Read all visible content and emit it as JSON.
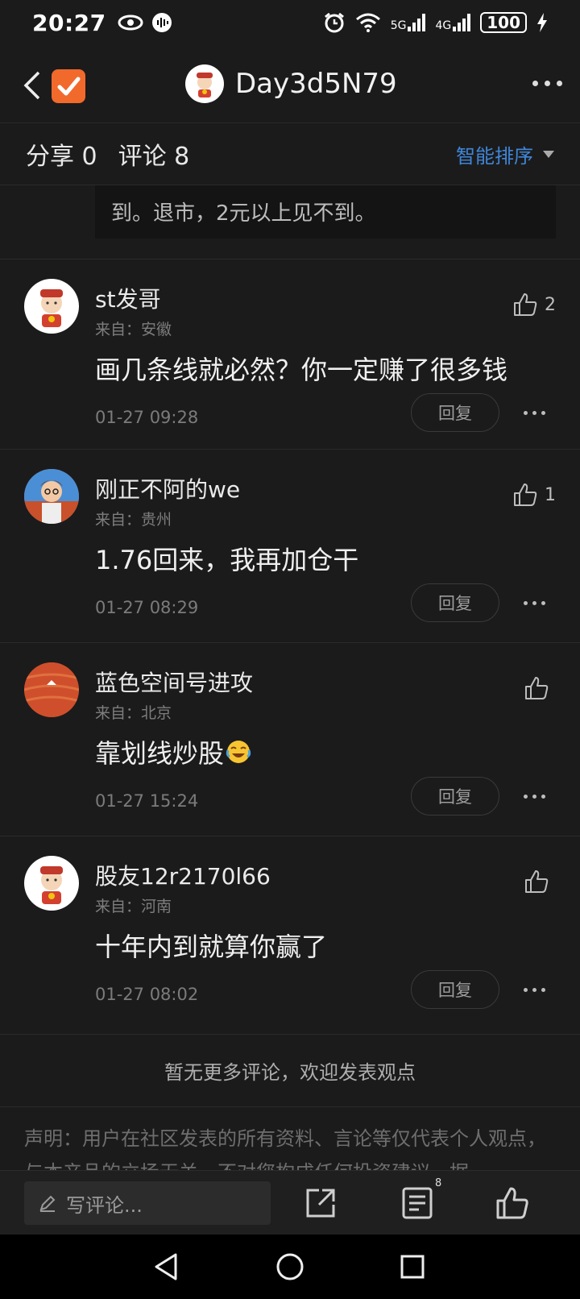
{
  "status_bar": {
    "time": "20:27",
    "battery": "100",
    "net1": "5G",
    "net2": "4G"
  },
  "topnav": {
    "title": "Day3d5N79"
  },
  "tabs": {
    "share": "分享 0",
    "comments": "评论 8",
    "sort": "智能排序"
  },
  "snippet": {
    "text": "到。退市，2元以上见不到。"
  },
  "comments": [
    {
      "name": "st发哥",
      "location": "来自：安徽",
      "text": "画几条线就必然？你一定赚了很多钱",
      "time": "01-27 09:28",
      "likes": "2",
      "reply": "回复"
    },
    {
      "name": "刚正不阿的we",
      "location": "来自：贵州",
      "text": "1.76回来，我再加仓干",
      "time": "01-27 08:29",
      "likes": "1",
      "reply": "回复"
    },
    {
      "name": "蓝色空间号进攻",
      "location": "来自：北京",
      "text": "靠划线炒股",
      "time": "01-27 15:24",
      "likes": "",
      "reply": "回复"
    },
    {
      "name": "股友12r2170l66",
      "location": "来自：河南",
      "text": "十年内到就算你赢了",
      "time": "01-27 08:02",
      "likes": "",
      "reply": "回复"
    }
  ],
  "no_more": "暂无更多评论，欢迎发表观点",
  "disclaimer": "声明：用户在社区发表的所有资料、言论等仅代表个人观点，与本产品的立场无关，不对您构成任何投资建议，据",
  "bottom_bar": {
    "write_placeholder": "写评论...",
    "comment_count": "8"
  },
  "colors": {
    "background": "#1b1b1b",
    "accent": "#3f86d8",
    "app_logo": "#f2692c"
  }
}
